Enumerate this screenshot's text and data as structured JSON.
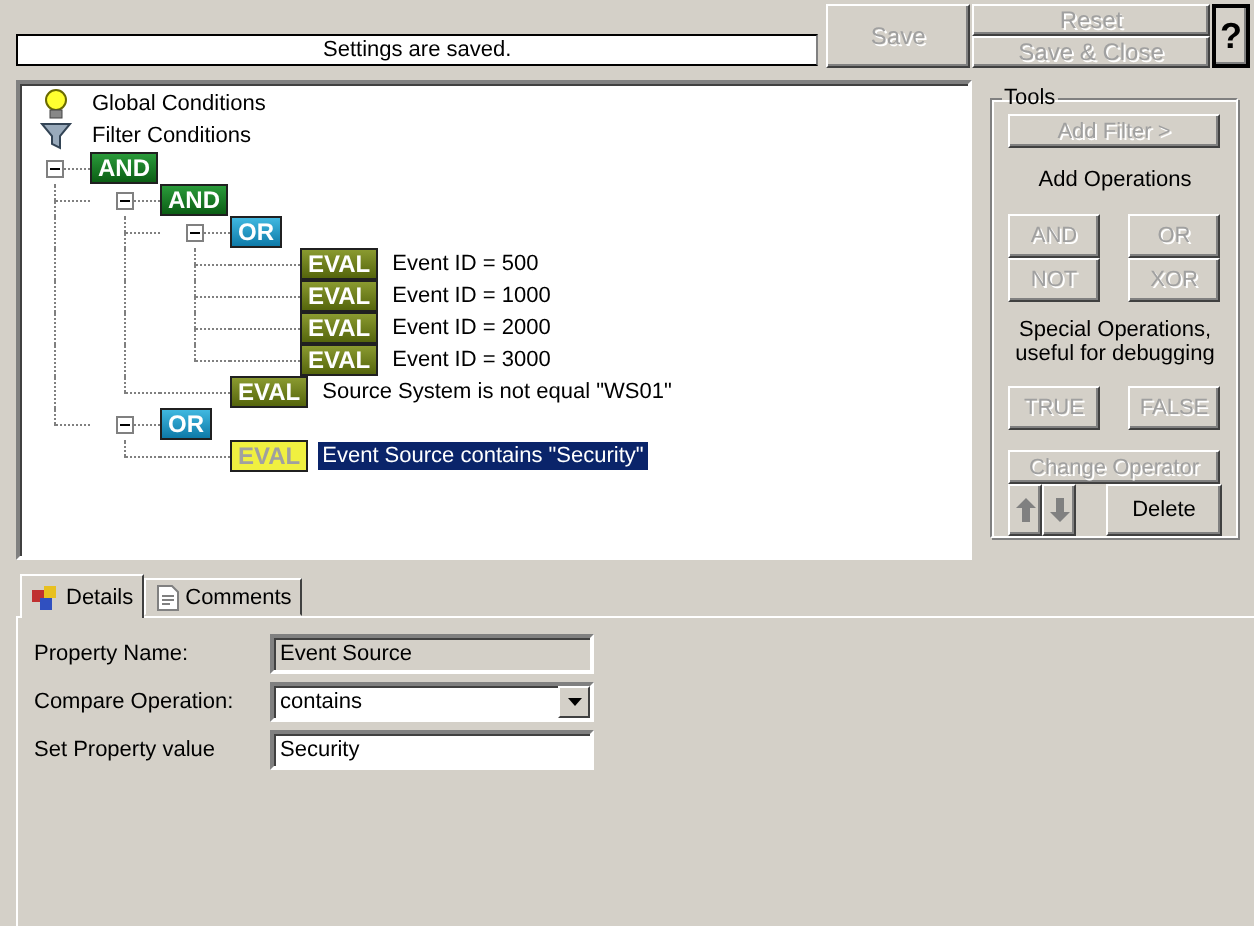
{
  "status_message": "Settings are saved.",
  "toolbar_buttons": [
    {
      "kind": "save",
      "label": "Save",
      "disabled": true
    },
    {
      "kind": "reset",
      "label": "Reset",
      "disabled": true
    },
    {
      "kind": "save-close",
      "label": "Save & Close",
      "disabled": true
    },
    {
      "kind": "help",
      "label": "?",
      "disabled": false
    }
  ],
  "tree": [
    {
      "kind": "global",
      "label": "Global Conditions"
    },
    {
      "kind": "filter",
      "label": "Filter Conditions"
    },
    {
      "kind": "and",
      "badge": "AND",
      "expanded": true,
      "selected": false,
      "children": [
        {
          "kind": "and",
          "badge": "AND",
          "expanded": true,
          "selected": false,
          "children": [
            {
              "kind": "or",
              "badge": "OR",
              "expanded": true,
              "selected": false,
              "children": [
                {
                  "kind": "eval",
                  "badge": "EVAL",
                  "label": "Event ID = 500",
                  "selected": false
                },
                {
                  "kind": "eval",
                  "badge": "EVAL",
                  "label": "Event ID = 1000",
                  "selected": false
                },
                {
                  "kind": "eval",
                  "badge": "EVAL",
                  "label": "Event ID = 2000",
                  "selected": false
                },
                {
                  "kind": "eval",
                  "badge": "EVAL",
                  "label": "Event ID = 3000",
                  "selected": false
                }
              ]
            },
            {
              "kind": "eval",
              "badge": "EVAL",
              "label": "Source System is not equal \"WS01\"",
              "selected": false
            }
          ]
        },
        {
          "kind": "or",
          "badge": "OR",
          "expanded": true,
          "selected": false,
          "children": [
            {
              "kind": "eval",
              "badge": "EVAL",
              "label": "Event Source contains \"Security\"",
              "selected": true
            }
          ]
        }
      ]
    }
  ],
  "tools": {
    "title": "Tools",
    "add_filter": {
      "label": "Add Filter >",
      "disabled": true
    },
    "operations_caption": "Add Operations",
    "operation_buttons": [
      {
        "label": "AND",
        "disabled": true
      },
      {
        "label": "OR",
        "disabled": true
      },
      {
        "label": "NOT",
        "disabled": true
      },
      {
        "label": "XOR",
        "disabled": true
      }
    ],
    "special_caption": "Special Operations, useful for debugging",
    "special_buttons": [
      {
        "label": "TRUE",
        "disabled": true
      },
      {
        "label": "FALSE",
        "disabled": true
      }
    ],
    "change_operator": {
      "label": "Change Operator",
      "disabled": true
    },
    "move_buttons": [
      {
        "kind": "up"
      },
      {
        "kind": "down"
      }
    ],
    "delete": {
      "label": "Delete",
      "disabled": false
    }
  },
  "tabs": [
    {
      "kind": "details",
      "label": "Details",
      "selected": true
    },
    {
      "kind": "comments",
      "label": "Comments",
      "selected": false
    }
  ],
  "form": [
    {
      "kind": "readonly",
      "label": "Property Name:",
      "value": "Event Source"
    },
    {
      "kind": "dropdown",
      "label": "Compare Operation:",
      "value": "contains"
    },
    {
      "kind": "text",
      "label": "Set Property value",
      "value": "Security"
    }
  ]
}
